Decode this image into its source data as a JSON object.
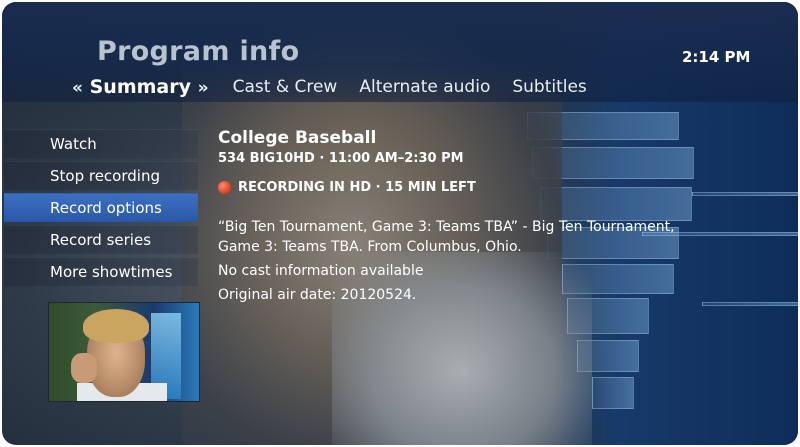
{
  "header": {
    "title": "Program info",
    "clock": "2:14 PM"
  },
  "tabs": {
    "left_chevron": "«",
    "right_chevron": "»",
    "active": "Summary",
    "items": [
      "Cast & Crew",
      "Alternate audio",
      "Subtitles"
    ]
  },
  "menu": {
    "items": [
      "Watch",
      "Stop recording",
      "Record options",
      "Record series",
      "More showtimes"
    ],
    "selected_index": 2
  },
  "program": {
    "title": "College Baseball",
    "channel_time": "534 BIG10HD · 11:00 AM–2:30 PM",
    "recording_status": "RECORDING IN HD · 15 MIN LEFT",
    "description": "“Big Ten Tournament, Game 3: Teams TBA” - Big Ten Tournament, Game 3: Teams TBA. From Columbus, Ohio.",
    "cast_info": "No cast information available",
    "original_air_date": "Original air date: 20120524."
  },
  "colors": {
    "selected_menu": "#2a58a8",
    "recording_dot": "#e0472a",
    "title_text": "#b9c3cf"
  }
}
